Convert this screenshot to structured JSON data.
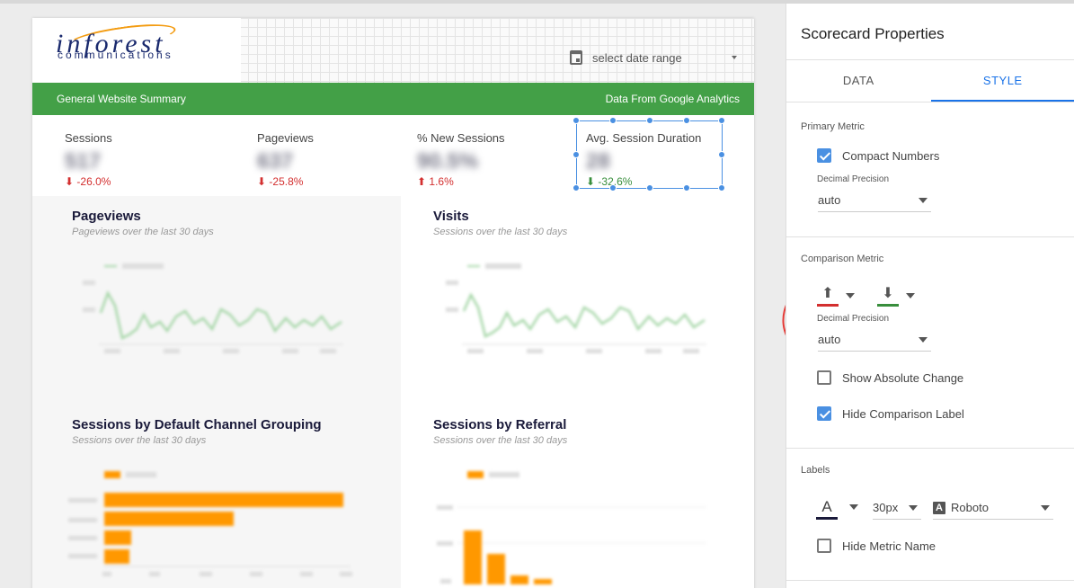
{
  "report": {
    "logo": {
      "main": "inforest",
      "sub": "communications"
    },
    "date_range": "select date range",
    "banner": {
      "left": "General Website Summary",
      "right": "Data From Google Analytics"
    },
    "scorecards": [
      {
        "label": "Sessions",
        "value": "517",
        "delta": "-26.0%",
        "arrow": "down",
        "color": "#d32f2f"
      },
      {
        "label": "Pageviews",
        "value": "637",
        "delta": "-25.8%",
        "arrow": "down",
        "color": "#d32f2f"
      },
      {
        "label": "% New Sessions",
        "value": "90.5%",
        "delta": "1.6%",
        "arrow": "up",
        "color": "#d32f2f"
      },
      {
        "label": "Avg. Session Duration",
        "value": "28",
        "delta": "-32.6%",
        "arrow": "down",
        "color": "#388e3c"
      }
    ],
    "panels": [
      {
        "title": "Pageviews",
        "subtitle": "Pageviews over the last 30 days"
      },
      {
        "title": "Visits",
        "subtitle": "Sessions over the last 30 days"
      },
      {
        "title": "Sessions by Default Channel Grouping",
        "subtitle": "Sessions over the last 30 days"
      },
      {
        "title": "Sessions by Referral",
        "subtitle": "Sessions over the last 30 days"
      }
    ]
  },
  "properties": {
    "title": "Scorecard Properties",
    "tabs": [
      {
        "label": "DATA",
        "active": false
      },
      {
        "label": "STYLE",
        "active": true
      }
    ],
    "primary_metric": {
      "label": "Primary Metric",
      "compact_numbers": {
        "label": "Compact Numbers",
        "checked": true
      },
      "decimal_label": "Decimal Precision",
      "decimal_value": "auto"
    },
    "comparison_metric": {
      "label": "Comparison Metric",
      "up_arrow": {
        "icon": "arrow-up-icon",
        "color": "#d32f2f"
      },
      "down_arrow": {
        "icon": "arrow-down-icon",
        "color": "#388e3c"
      },
      "decimal_label": "Decimal Precision",
      "decimal_value": "auto",
      "show_absolute": {
        "label": "Show Absolute Change",
        "checked": false
      },
      "hide_comparison": {
        "label": "Hide Comparison Label",
        "checked": true
      }
    },
    "labels": {
      "label": "Labels",
      "font_color": "#1a1a3a",
      "font_size": "30px",
      "font_family": "Roboto",
      "hide_metric_name": {
        "label": "Hide Metric Name",
        "checked": false
      }
    }
  },
  "colors": {
    "accent": "#1a73e8",
    "banner": "#43a047",
    "chart_series": "#ff9800",
    "line": "#a5d6a7"
  }
}
